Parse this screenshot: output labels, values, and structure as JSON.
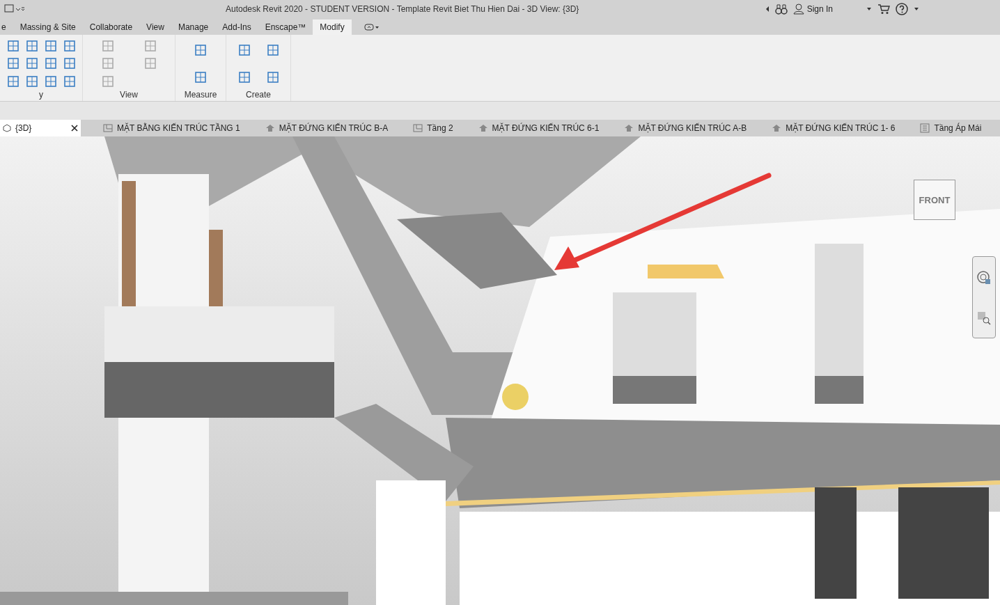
{
  "window": {
    "title": "Autodesk Revit 2020 - STUDENT VERSION - Template Revit Biet Thu Hien Dai - 3D View: {3D}"
  },
  "account": {
    "sign_in": "Sign In"
  },
  "ribbon_tabs": [
    {
      "label": "e",
      "selected": false
    },
    {
      "label": "Massing & Site",
      "selected": false
    },
    {
      "label": "Collaborate",
      "selected": false
    },
    {
      "label": "View",
      "selected": false
    },
    {
      "label": "Manage",
      "selected": false
    },
    {
      "label": "Add-Ins",
      "selected": false
    },
    {
      "label": "Enscape™",
      "selected": false
    },
    {
      "label": "Modify",
      "selected": true
    }
  ],
  "ribbon_panels": [
    {
      "label": "y",
      "kind": "modify"
    },
    {
      "label": "View",
      "kind": "view"
    },
    {
      "label": "Measure",
      "kind": "measure"
    },
    {
      "label": "Create",
      "kind": "create"
    }
  ],
  "view_tabs": [
    {
      "label": "{3D}",
      "kind": "model",
      "selected": true
    },
    {
      "label": "MẶT BẰNG KIẾN TRÚC TẦNG 1",
      "kind": "plan",
      "selected": false
    },
    {
      "label": "MẶT ĐỨNG KIẾN TRÚC B-A",
      "kind": "elevation",
      "selected": false
    },
    {
      "label": "Tầng 2",
      "kind": "plan",
      "selected": false
    },
    {
      "label": "MẶT ĐỨNG KIẾN TRÚC 6-1",
      "kind": "elevation",
      "selected": false
    },
    {
      "label": "MẶT ĐỨNG KIẾN TRÚC A-B",
      "kind": "elevation",
      "selected": false
    },
    {
      "label": "MẶT ĐỨNG KIẾN TRÚC 1- 6",
      "kind": "elevation",
      "selected": false
    },
    {
      "label": "Tầng Áp Mái",
      "kind": "sheet",
      "selected": false
    }
  ],
  "view_cube": {
    "face": "FRONT"
  }
}
